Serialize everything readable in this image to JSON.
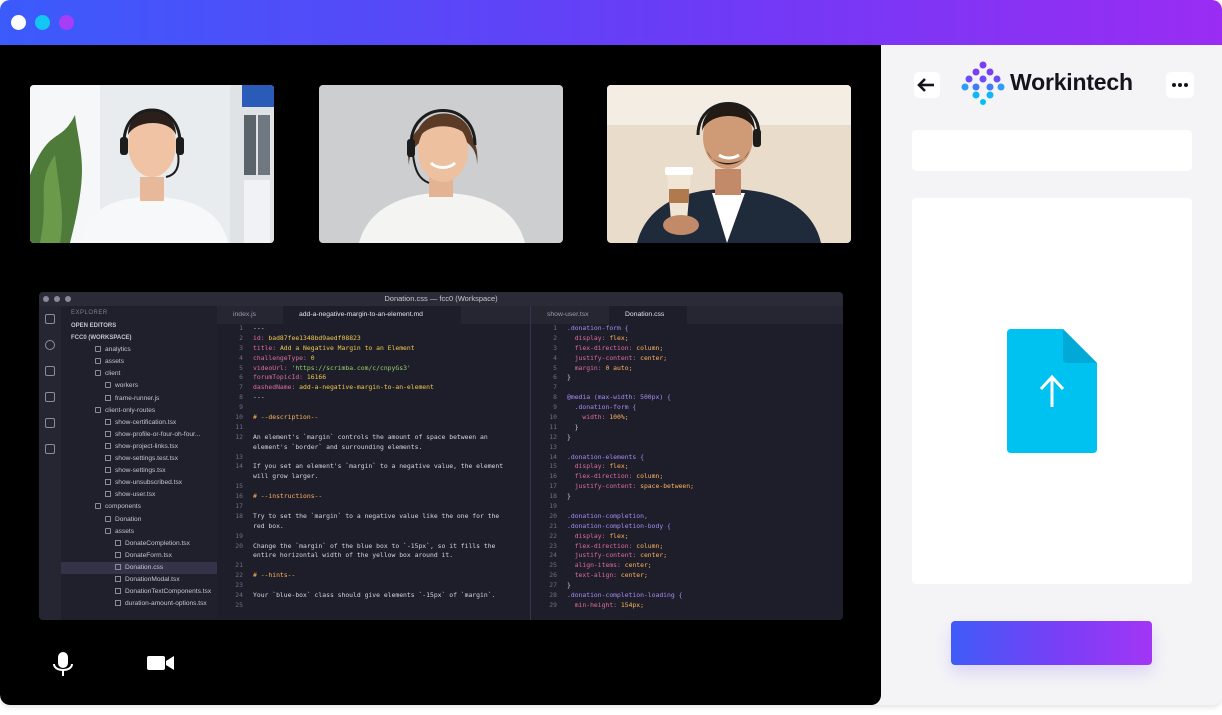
{
  "app": {
    "brand": "Workintech"
  },
  "colors": {
    "title_gradient_start": "#3b5bfb",
    "title_gradient_end": "#9a2cf3",
    "accent_cyan": "#00c2f0"
  },
  "participants": [
    {
      "name": "",
      "icon": "participant-video"
    },
    {
      "name": "",
      "icon": "participant-video"
    },
    {
      "name": "",
      "icon": "participant-video"
    }
  ],
  "editor": {
    "window_title": "Donation.css — fcc0 (Workspace)",
    "explorer_label": "EXPLORER",
    "sections": [
      "OPEN EDITORS",
      "FCC0 (WORKSPACE)"
    ],
    "tree": [
      "analytics",
      "assets",
      "client",
      "workers",
      "frame-runner.js",
      "client-only-routes",
      "show-certification.tsx",
      "show-profile-or-four-oh-four...",
      "show-project-links.tsx",
      "show-settings.test.tsx",
      "show-settings.tsx",
      "show-unsubscribed.tsx",
      "show-user.tsx",
      "components",
      "Donation",
      "assets",
      "DonateCompletion.tsx",
      "DonateForm.tsx",
      "Donation.css",
      "DonationModal.tsx",
      "DonationTextComponents.tsx",
      "duration-amount-options.tsx"
    ],
    "tabs_left": [
      "index.js",
      "add-a-negative-margin-to-an-element.md"
    ],
    "tabs_right": [
      "show-user.tsx",
      "Donation.css"
    ],
    "left_code": [
      [
        "1",
        "---"
      ],
      [
        "2",
        "id: bad87fee1348bd9aedf08823"
      ],
      [
        "3",
        "title: Add a Negative Margin to an Element"
      ],
      [
        "4",
        "challengeType: 0"
      ],
      [
        "5",
        "videoUrl: 'https://scrimba.com/c/cnpyGs3'"
      ],
      [
        "6",
        "forumTopicId: 16166"
      ],
      [
        "7",
        "dashedName: add-a-negative-margin-to-an-element"
      ],
      [
        "8",
        "---"
      ],
      [
        "9",
        ""
      ],
      [
        "10",
        "# --description--"
      ],
      [
        "11",
        ""
      ],
      [
        "12",
        "An element's `margin` controls the amount of space between an"
      ],
      [
        "",
        "element's `border` and surrounding elements."
      ],
      [
        "13",
        ""
      ],
      [
        "14",
        "If you set an element's `margin` to a negative value, the element"
      ],
      [
        "",
        "will grow larger."
      ],
      [
        "15",
        ""
      ],
      [
        "16",
        "# --instructions--"
      ],
      [
        "17",
        ""
      ],
      [
        "18",
        "Try to set the `margin` to a negative value like the one for the"
      ],
      [
        "",
        "red box."
      ],
      [
        "19",
        ""
      ],
      [
        "20",
        "Change the `margin` of the blue box to `-15px`, so it fills the"
      ],
      [
        "",
        "entire horizontal width of the yellow box around it."
      ],
      [
        "21",
        ""
      ],
      [
        "22",
        "# --hints--"
      ],
      [
        "23",
        ""
      ],
      [
        "24",
        "Your `blue-box` class should give elements `-15px` of `margin`."
      ],
      [
        "25",
        ""
      ]
    ],
    "right_code": [
      [
        "1",
        ".donation-form {"
      ],
      [
        "2",
        "  display: flex;"
      ],
      [
        "3",
        "  flex-direction: column;"
      ],
      [
        "4",
        "  justify-content: center;"
      ],
      [
        "5",
        "  margin: 0 auto;"
      ],
      [
        "6",
        "}"
      ],
      [
        "7",
        ""
      ],
      [
        "8",
        "@media (max-width: 500px) {"
      ],
      [
        "9",
        "  .donation-form {"
      ],
      [
        "10",
        "    width: 100%;"
      ],
      [
        "11",
        "  }"
      ],
      [
        "12",
        "}"
      ],
      [
        "13",
        ""
      ],
      [
        "14",
        ".donation-elements {"
      ],
      [
        "15",
        "  display: flex;"
      ],
      [
        "16",
        "  flex-direction: column;"
      ],
      [
        "17",
        "  justify-content: space-between;"
      ],
      [
        "18",
        "}"
      ],
      [
        "19",
        ""
      ],
      [
        "20",
        ".donation-completion,"
      ],
      [
        "21",
        ".donation-completion-body {"
      ],
      [
        "22",
        "  display: flex;"
      ],
      [
        "23",
        "  flex-direction: column;"
      ],
      [
        "24",
        "  justify-content: center;"
      ],
      [
        "25",
        "  align-items: center;"
      ],
      [
        "26",
        "  text-align: center;"
      ],
      [
        "27",
        "}"
      ],
      [
        "28",
        ".donation-completion-loading {"
      ],
      [
        "29",
        "  min-height: 154px;"
      ]
    ]
  },
  "controls": {
    "mic": "microphone-icon",
    "camera": "video-camera-icon"
  },
  "panel": {
    "back": "back-arrow-icon",
    "more": "more-options-icon",
    "upload": "file-upload-icon",
    "field_value": "",
    "cta_label": ""
  }
}
